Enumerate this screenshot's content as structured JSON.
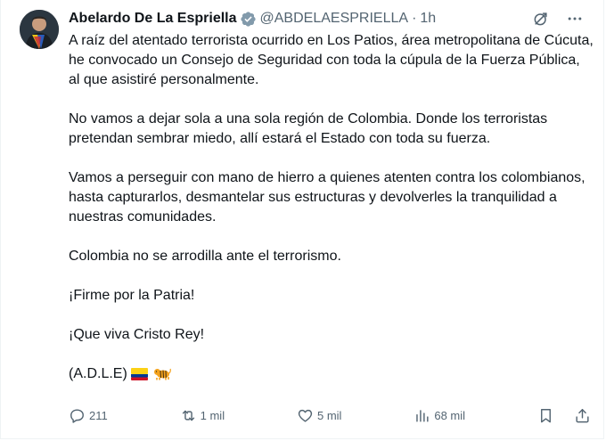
{
  "author": {
    "display_name": "Abelardo De La Espriella",
    "handle": "@ABDELAESPRIELLA",
    "separator": "·",
    "time": "1h",
    "verified": true
  },
  "tweet": {
    "paragraphs": [
      "A raíz del atentado terrorista ocurrido en Los Patios, área metropolitana de Cúcuta, he convocado un Consejo de Seguridad con toda la cúpula de la Fuerza Pública, al que asistiré personalmente.",
      "No vamos a dejar sola a una sola región de Colombia. Donde los terroristas pretendan sembrar miedo, allí estará el Estado con toda su fuerza.",
      "Vamos a perseguir con mano de hierro a quienes atenten contra los colombianos, hasta capturarlos, desmantelar sus estructuras y devolverles la tranquilidad a nuestras comunidades.",
      "Colombia no se arrodilla ante el terrorismo.",
      "¡Firme por la Patria!",
      "¡Que viva Cristo Rey!"
    ],
    "signature": "(A.D.L.E)",
    "signature_emoji": [
      "colombia-flag-icon",
      "tiger-icon"
    ]
  },
  "actions": {
    "replies": "211",
    "reposts": "1 mil",
    "likes": "5 mil",
    "views": "68 mil"
  },
  "colors": {
    "text": "#0f1419",
    "secondary": "#536471",
    "verified": "#829aab",
    "border": "#eff3f4"
  }
}
